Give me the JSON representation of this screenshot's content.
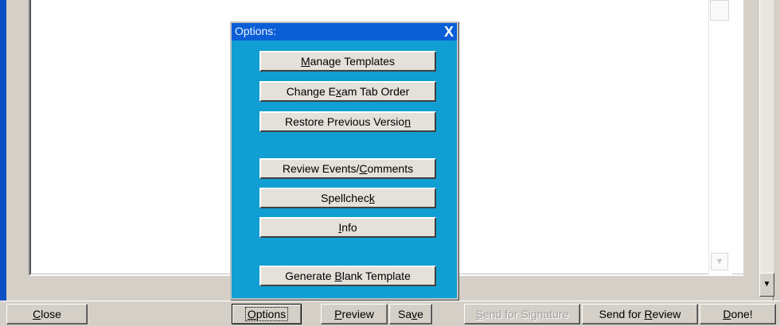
{
  "dialog": {
    "title": "Options:",
    "close_symbol": "X",
    "buttons": [
      {
        "pre": "",
        "u": "M",
        "post": "anage Templates"
      },
      {
        "pre": "Change E",
        "u": "x",
        "post": "am Tab Order"
      },
      {
        "pre": "Restore Previous Versio",
        "u": "n",
        "post": ""
      },
      {
        "pre": "Review Events/",
        "u": "C",
        "post": "omments"
      },
      {
        "pre": "Spellchec",
        "u": "k",
        "post": ""
      },
      {
        "pre": "",
        "u": "I",
        "post": "nfo"
      },
      {
        "pre": "Generate ",
        "u": "B",
        "post": "lank Template"
      }
    ]
  },
  "toolbar": {
    "close": {
      "pre": "",
      "u": "C",
      "post": "lose"
    },
    "options": {
      "pre": "",
      "u": "O",
      "post": "ptions"
    },
    "preview": {
      "pre": "",
      "u": "P",
      "post": "review"
    },
    "save": {
      "pre": "Sa",
      "u": "v",
      "post": "e"
    },
    "send_signature": {
      "pre": "",
      "u": "S",
      "post": "end for Signature"
    },
    "send_review": {
      "pre": "Send for ",
      "u": "R",
      "post": "eview"
    },
    "done": {
      "pre": "",
      "u": "D",
      "post": "one!"
    }
  },
  "scroll": {
    "down_arrow": "▼",
    "inner_down_arrow": "▼"
  }
}
